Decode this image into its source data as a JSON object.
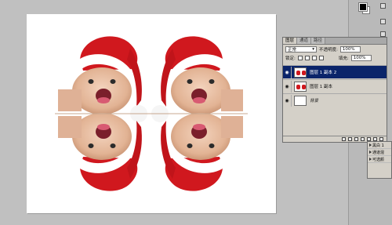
{
  "layers_panel": {
    "tabs": [
      "图层",
      "通道",
      "路径"
    ],
    "blend_mode": "正常",
    "opacity_label": "不透明度:",
    "opacity_value": "100%",
    "lock_label": "锁定:",
    "fill_label": "填充:",
    "fill_value": "100%",
    "layers": [
      {
        "name": "图层 1 副本 2",
        "selected": true
      },
      {
        "name": "图层 1 副本",
        "selected": false
      },
      {
        "name": "背景",
        "selected": false
      }
    ]
  },
  "history_panel": {
    "items": [
      "黑白 1",
      "通道混",
      "可选颜"
    ]
  },
  "colors": {
    "selection": "#0a246a",
    "panel_bg": "#d4d0c8",
    "workspace_bg": "#c0c0c0",
    "hat_red": "#d0181e"
  },
  "icons": {
    "visibility": "eye-icon",
    "lock": "lock-icon",
    "dropdown": "chevron-down-icon"
  }
}
